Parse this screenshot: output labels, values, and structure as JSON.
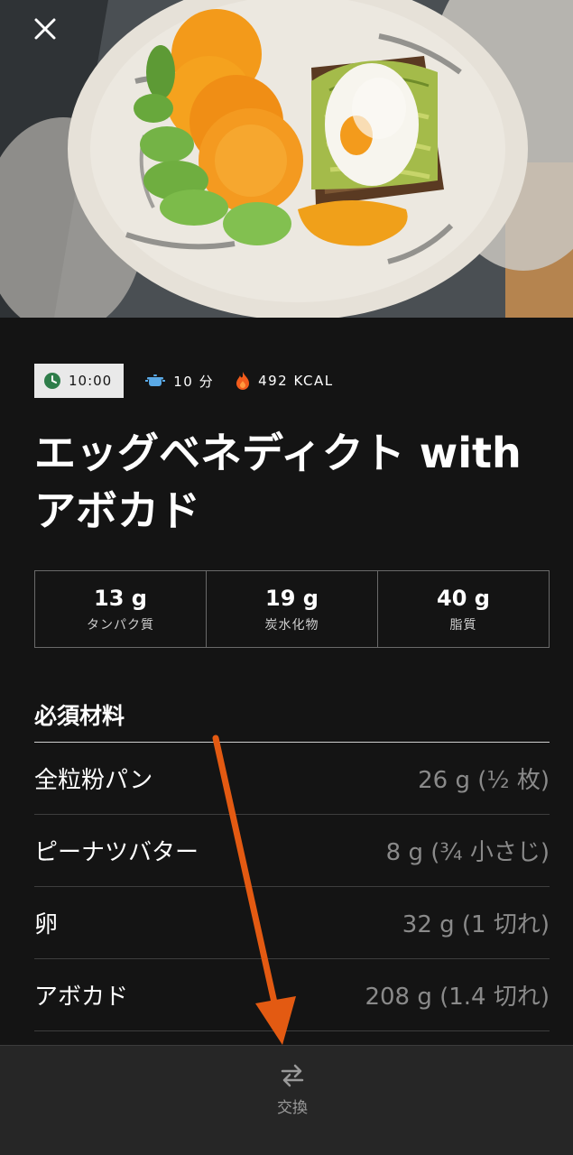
{
  "header": {
    "close_icon": "close-icon"
  },
  "hero": {
    "image": "avocado-toast-with-poached-egg-tomato-cucumber-plate"
  },
  "meta": {
    "timer": "10:00",
    "cook_time": "10 分",
    "calories": "492 KCAL",
    "timer_icon": "clock-icon",
    "pot_icon": "pot-icon",
    "flame_icon": "flame-icon",
    "colors": {
      "timer_bg": "#e9e9e9",
      "pot": "#5aa9e6",
      "flame": "#f25c1c"
    }
  },
  "recipe": {
    "title_line1": "エッグベネディクト with",
    "title_line2": "アボカド"
  },
  "macros": [
    {
      "value": "13 g",
      "label": "タンパク質"
    },
    {
      "value": "19 g",
      "label": "炭水化物"
    },
    {
      "value": "40 g",
      "label": "脂質"
    }
  ],
  "ingredients": {
    "title": "必須材料",
    "items": [
      {
        "name": "全粒粉パン",
        "amount": "26 g (½ 枚)"
      },
      {
        "name": "ピーナツバター",
        "amount": "8 g (¾ 小さじ)"
      },
      {
        "name": "卵",
        "amount": "32 g (1 切れ)"
      },
      {
        "name": "アボカド",
        "amount": "208 g (1.4 切れ)"
      }
    ]
  },
  "bottom_bar": {
    "swap_label": "交換",
    "swap_icon": "swap-arrows-icon"
  },
  "annotation": {
    "arrow_color": "#e35a12"
  }
}
